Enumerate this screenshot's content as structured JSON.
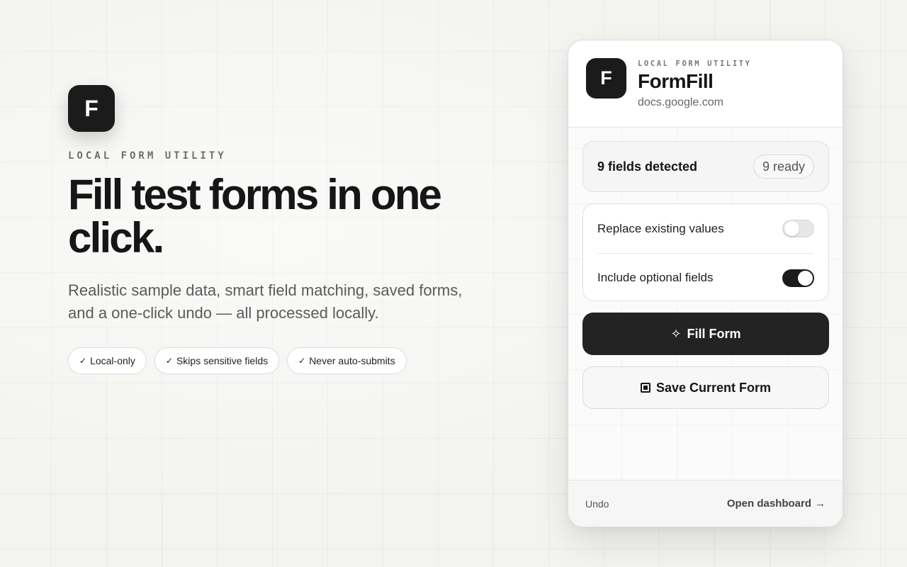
{
  "hero": {
    "logo_letter": "F",
    "eyebrow": "LOCAL FORM UTILITY",
    "headline": "Fill test forms in one click.",
    "subhead": "Realistic sample data, smart field matching, saved forms, and a one-click undo — all processed locally.",
    "pills": [
      {
        "check": "✓",
        "label": "Local-only"
      },
      {
        "check": "✓",
        "label": "Skips sensitive fields"
      },
      {
        "check": "✓",
        "label": "Never auto-submits"
      }
    ]
  },
  "popup": {
    "logo_letter": "F",
    "eyebrow": "LOCAL FORM UTILITY",
    "title": "FormFill",
    "domain": "docs.google.com",
    "detection": {
      "label": "9 fields detected",
      "badge": "9 ready"
    },
    "options": [
      {
        "label": "Replace existing values",
        "enabled": false
      },
      {
        "label": "Include optional fields",
        "enabled": true
      }
    ],
    "primary_button": {
      "icon": "✧",
      "label": "Fill Form"
    },
    "secondary_button": {
      "icon": "save-icon",
      "label": "Save Current Form"
    },
    "footer": {
      "undo_label": "Undo",
      "dashboard_label": "Open dashboard",
      "dashboard_arrow": "→"
    }
  },
  "colors": {
    "accent_dark": "#1b1b1b",
    "background": "#f3f3f0"
  }
}
